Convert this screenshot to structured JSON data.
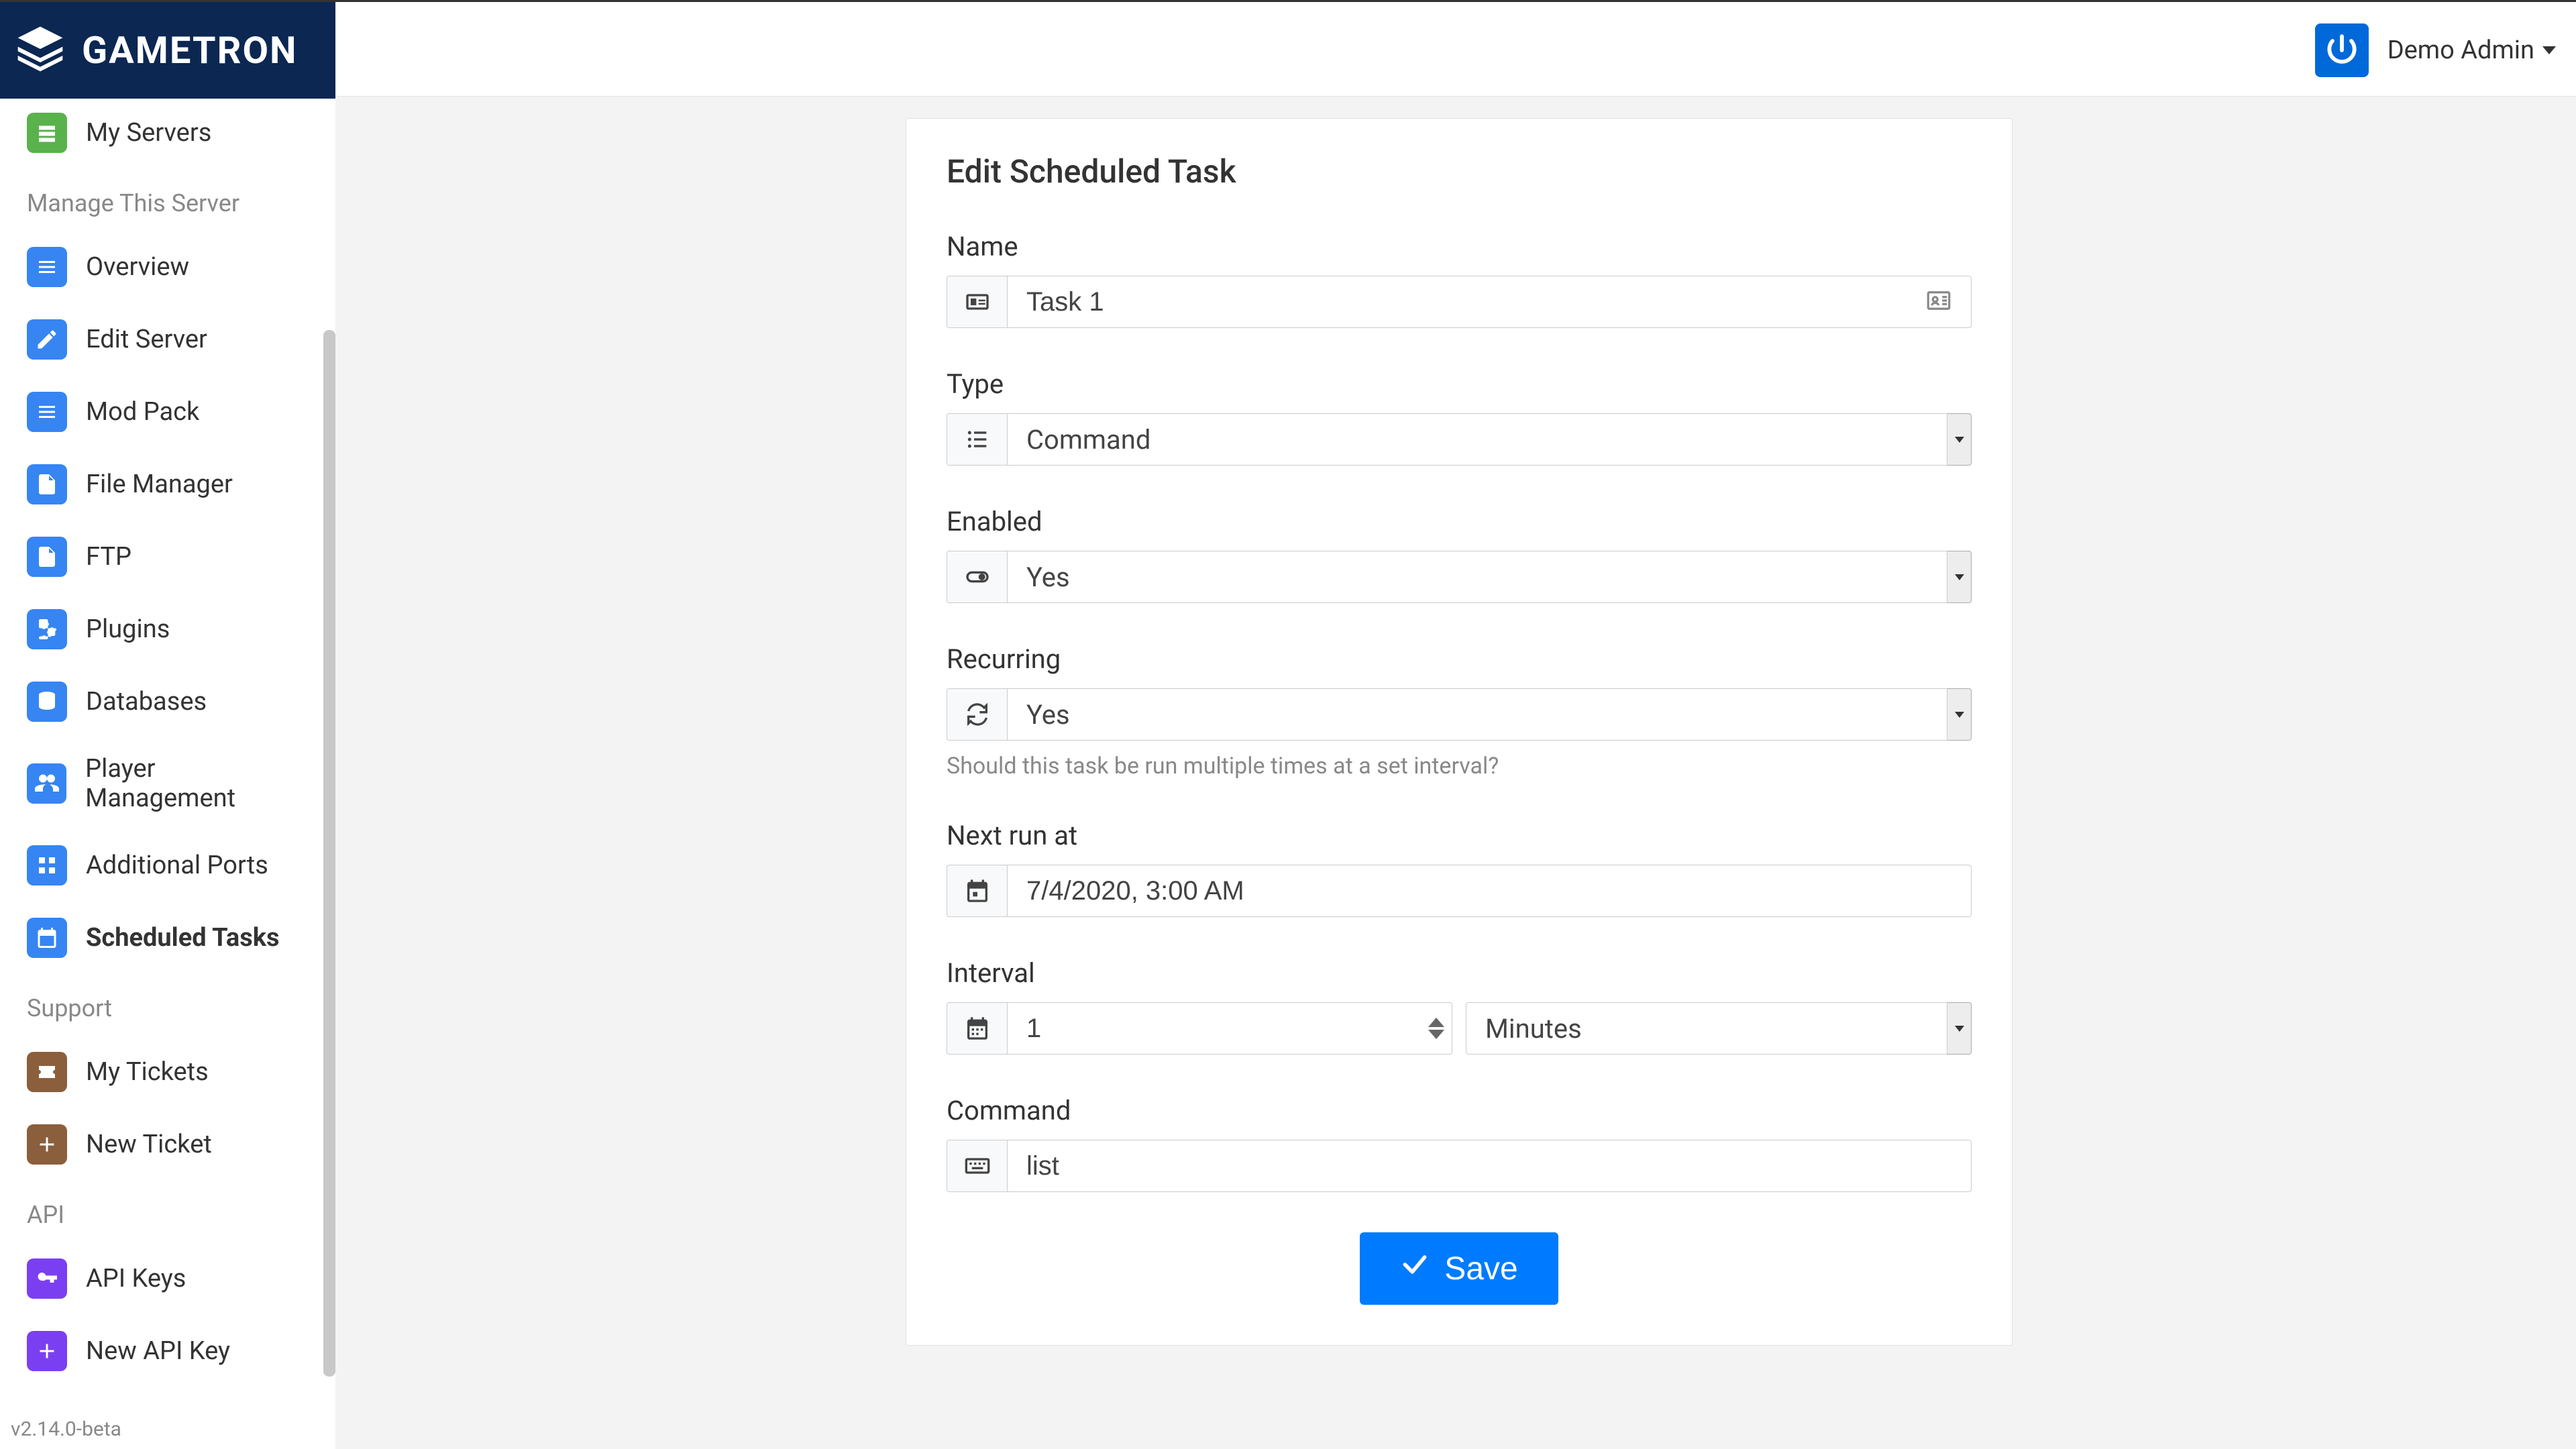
{
  "header": {
    "brand": "GAMETRON",
    "user_name": "Demo Admin"
  },
  "sidebar": {
    "my_servers": "My Servers",
    "section_manage": "Manage This Server",
    "items": [
      {
        "label": "Overview"
      },
      {
        "label": "Edit Server"
      },
      {
        "label": "Mod Pack"
      },
      {
        "label": "File Manager"
      },
      {
        "label": "FTP"
      },
      {
        "label": "Plugins"
      },
      {
        "label": "Databases"
      },
      {
        "label": "Player Management"
      },
      {
        "label": "Additional Ports"
      },
      {
        "label": "Scheduled Tasks"
      }
    ],
    "section_support": "Support",
    "support": [
      {
        "label": "My Tickets"
      },
      {
        "label": "New Ticket"
      }
    ],
    "section_api": "API",
    "api": [
      {
        "label": "API Keys"
      },
      {
        "label": "New API Key"
      }
    ],
    "version": "v2.14.0-beta"
  },
  "card": {
    "title": "Edit Scheduled Task",
    "name_label": "Name",
    "name_value": "Task 1",
    "type_label": "Type",
    "type_value": "Command",
    "enabled_label": "Enabled",
    "enabled_value": "Yes",
    "recurring_label": "Recurring",
    "recurring_value": "Yes",
    "recurring_help": "Should this task be run multiple times at a set interval?",
    "nextrun_label": "Next run at",
    "nextrun_value": "7/4/2020, 3:00 AM",
    "interval_label": "Interval",
    "interval_value": "1",
    "interval_unit": "Minutes",
    "command_label": "Command",
    "command_value": "list",
    "save_label": "Save"
  }
}
